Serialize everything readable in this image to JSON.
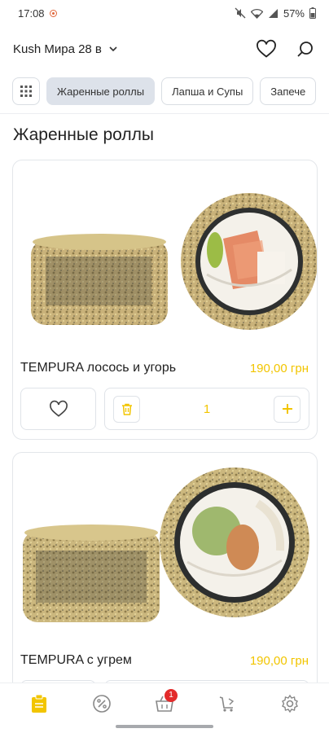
{
  "status_bar": {
    "time": "17:08",
    "battery": "57%",
    "icons": [
      "recording-icon",
      "mute-icon",
      "wifi-icon",
      "signal-icon",
      "battery-icon"
    ]
  },
  "header": {
    "location": "Kush Мира 28 в",
    "icons": [
      "chevron-down-icon",
      "heart-icon",
      "search-icon"
    ]
  },
  "tabs": {
    "items": [
      {
        "label": "Жаренные роллы",
        "active": true
      },
      {
        "label": "Лапша и Супы",
        "active": false
      },
      {
        "label": "Запече",
        "active": false
      }
    ]
  },
  "section_title": "Жаренные роллы",
  "products": [
    {
      "name": "TEMPURA  лосось и угорь",
      "price": "190,00 грн",
      "quantity": "1"
    },
    {
      "name": "TEMPURA  с угрем",
      "price": "190,00 грн"
    }
  ],
  "bottom_nav": {
    "items": [
      "menu-icon",
      "percent-icon",
      "basket-icon",
      "cart-icon",
      "settings-icon"
    ],
    "cart_badge": "1"
  },
  "colors": {
    "accent": "#f2c500",
    "badge": "#e32b2b",
    "active_tab": "#dde2ea"
  }
}
